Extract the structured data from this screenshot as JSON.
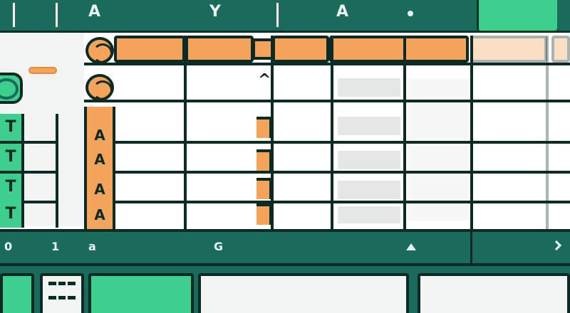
{
  "toolbar": {
    "glyphs": [
      "A",
      "Y",
      "A"
    ],
    "colors": {
      "bar": "#1a6b5c",
      "accent": "#3ecf8e",
      "dark": "#0d2b25"
    }
  },
  "sidebar": {
    "keys": [
      "T",
      "T",
      "T",
      "T"
    ],
    "icons": [
      "app-logo-icon",
      "slider-icon"
    ]
  },
  "grid": {
    "header_color": "#f3a45a",
    "row_labels": [
      "A",
      "A",
      "A",
      "A"
    ],
    "column_glyph": "^",
    "icons": [
      "record-circle-icon",
      "record-circle-icon"
    ]
  },
  "statusbar": {
    "items": [
      "0",
      "1",
      "a",
      "G"
    ],
    "right_icons": [
      "triangle-up-icon",
      "chevron-right-icon"
    ]
  },
  "bottombar": {
    "icons": [
      "table-grid-icon"
    ]
  }
}
